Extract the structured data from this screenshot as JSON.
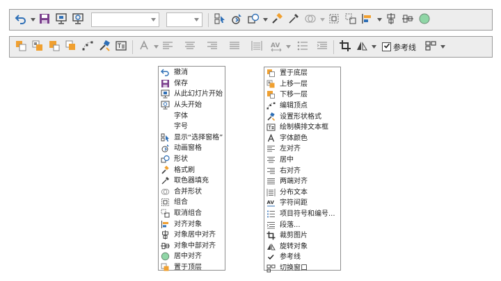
{
  "toolbar_top": {
    "font_name_value": "",
    "font_size_value": ""
  },
  "toolbar_bottom": {
    "guides_label": "参考线",
    "guides_checked": true
  },
  "menu_left": {
    "items": [
      {
        "label": "撤消",
        "icon": "undo-icon"
      },
      {
        "label": "保存",
        "icon": "save-icon"
      },
      {
        "label": "从此幻灯片开始",
        "icon": "slideshow-from-current-icon"
      },
      {
        "label": "从头开始",
        "icon": "slideshow-from-start-icon"
      },
      {
        "label": "字体",
        "icon": ""
      },
      {
        "label": "字号",
        "icon": ""
      },
      {
        "label": "显示“选择窗格”",
        "icon": "selection-pane-icon"
      },
      {
        "label": "动画窗格",
        "icon": "animation-pane-icon"
      },
      {
        "label": "形状",
        "icon": "shapes-icon"
      },
      {
        "label": "格式刷",
        "icon": "format-painter-icon"
      },
      {
        "label": "取色器填充",
        "icon": "eyedropper-icon"
      },
      {
        "label": "合并形状",
        "icon": "merge-shapes-icon"
      },
      {
        "label": "组合",
        "icon": "group-icon"
      },
      {
        "label": "取消组合",
        "icon": "ungroup-icon"
      },
      {
        "label": "对齐对象",
        "icon": "align-objects-icon"
      },
      {
        "label": "对象居中对齐",
        "icon": "align-center-icon"
      },
      {
        "label": "对象中部对齐",
        "icon": "align-middle-icon"
      },
      {
        "label": "居中对齐",
        "icon": "center-align-icon"
      },
      {
        "label": "置于顶层",
        "icon": "bring-to-front-icon"
      }
    ]
  },
  "menu_right": {
    "items": [
      {
        "label": "置于底层",
        "icon": "send-to-back-icon"
      },
      {
        "label": "上移一层",
        "icon": "bring-forward-icon"
      },
      {
        "label": "下移一层",
        "icon": "send-backward-icon"
      },
      {
        "label": "编辑顶点",
        "icon": "edit-points-icon"
      },
      {
        "label": "设置形状格式",
        "icon": "format-shape-icon"
      },
      {
        "label": "绘制横排文本框",
        "icon": "text-box-icon"
      },
      {
        "label": "字体颜色",
        "icon": "font-color-icon"
      },
      {
        "label": "左对齐",
        "icon": "align-left-icon"
      },
      {
        "label": "居中",
        "icon": "align-text-center-icon"
      },
      {
        "label": "右对齐",
        "icon": "align-right-icon"
      },
      {
        "label": "两端对齐",
        "icon": "justify-icon"
      },
      {
        "label": "分布文本",
        "icon": "distribute-text-icon"
      },
      {
        "label": "字符间距",
        "icon": "character-spacing-icon"
      },
      {
        "label": "项目符号和编号...",
        "icon": "bullets-icon"
      },
      {
        "label": "段落...",
        "icon": "paragraph-icon"
      },
      {
        "label": "裁剪图片",
        "icon": "crop-icon"
      },
      {
        "label": "旋转对象",
        "icon": "rotate-icon"
      },
      {
        "label": "参考线",
        "icon": "checkmark-icon"
      },
      {
        "label": "切换窗口",
        "icon": "switch-windows-icon"
      }
    ]
  },
  "colors": {
    "accent_blue": "#2e6fb6",
    "accent_purple": "#7a3e8c",
    "accent_orange": "#f0a030",
    "shape_green": "#8fd6a6"
  }
}
